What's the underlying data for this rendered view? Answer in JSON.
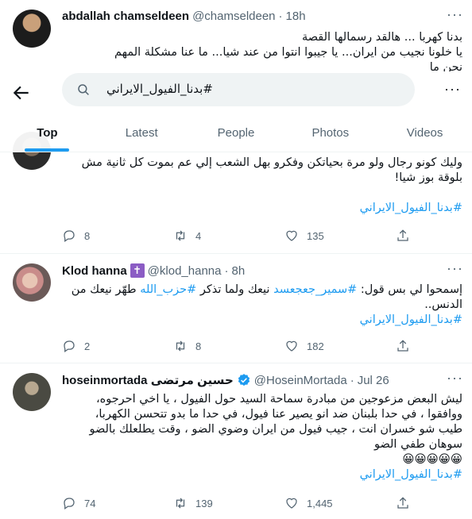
{
  "search": {
    "query": "#بدنا_الفيول_الايراني"
  },
  "tabs": [
    {
      "label": "Top",
      "active": true
    },
    {
      "label": "Latest",
      "active": false
    },
    {
      "label": "People",
      "active": false
    },
    {
      "label": "Photos",
      "active": false
    },
    {
      "label": "Videos",
      "active": false
    }
  ],
  "tweets": [
    {
      "name": "abdallah chamseldeen",
      "handle": "@chamseldeen",
      "separator": "·",
      "time": "18h",
      "lines": [
        "بدنا كهربا ... هالقد رسمالها القصة",
        "يا خلونا نجيب من ايران... يا جيبوا انتوا من عند شيا... ما عنا مشكلة المهم",
        "نحن ما"
      ]
    },
    {
      "lines": [
        "وليك كونو رجال ولو مرة بحياتكن وفكرو بهل الشعب إلي عم بموت كل ثانية مش",
        "بلوقة بوز شيا!"
      ],
      "hashtag": "#بدنا_الفيول_الايراني",
      "replies": "8",
      "retweets": "4",
      "likes": "135"
    },
    {
      "name": "Klod hanna",
      "badge": "✝",
      "handle": "@klod_hanna",
      "separator": "·",
      "time": "8h",
      "line1_prefix": "إسمحوا لي بس قول: ",
      "link1": "#سمير_جعجعسد",
      "line1_mid": " نيعك ولما تذكر ",
      "link2": "#حزب_الله",
      "line1_suffix": " طهّر نيعك من",
      "line2": "الدنس..",
      "hashtag": "#بدنا_الفيول_الايراني",
      "replies": "2",
      "retweets": "8",
      "likes": "182"
    },
    {
      "name": "hoseinmortada حسين مرتضى",
      "handle": "@HoseinMortada",
      "separator": "·",
      "time": "Jul 26",
      "lines": [
        "ليش البعض مزعوجين من مبادرة سماحة السيد حول الفيول ، يا اخي احرجوه،",
        "ووافقوا ، في حدا بلبنان ضد انو يصير عنا فيول، في حدا ما بدو تتحسن الكهربا،",
        "طيب شو خسران انت ، جيب فيول من ايران وضوي الضو ، وقت يطلعلك بالضو",
        "سوهان طفي الضو",
        "😀😀😀😀😀"
      ],
      "hashtag": "#بدنا_الفيول_الايراني",
      "replies": "74",
      "retweets": "139",
      "likes": "1,445"
    }
  ]
}
